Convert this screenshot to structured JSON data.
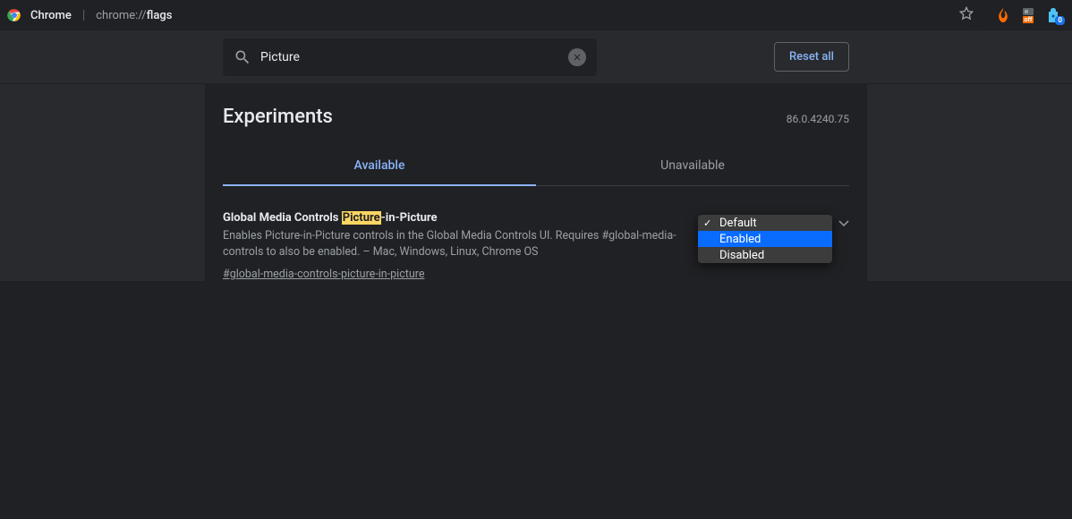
{
  "browser": {
    "name": "Chrome",
    "url_prefix": "chrome://",
    "url_page": "flags",
    "extensions": {
      "off_badge": "off",
      "blue_badge": "0"
    }
  },
  "header": {
    "search_value": "Picture",
    "reset_label": "Reset all"
  },
  "page": {
    "title": "Experiments",
    "version": "86.0.4240.75"
  },
  "tabs": {
    "available": "Available",
    "unavailable": "Unavailable"
  },
  "flag": {
    "title_pre": "Global Media Controls ",
    "title_hl": "Picture",
    "title_post": "-in-Picture",
    "description": "Enables Picture-in-Picture controls in the Global Media Controls UI. Requires #global-media-controls to also be enabled. – Mac, Windows, Linux, Chrome OS",
    "hash": "#global-media-controls-picture-in-picture"
  },
  "dropdown": {
    "options": {
      "default": "Default",
      "enabled": "Enabled",
      "disabled": "Disabled"
    },
    "selected": "Default",
    "hover": "Enabled"
  }
}
